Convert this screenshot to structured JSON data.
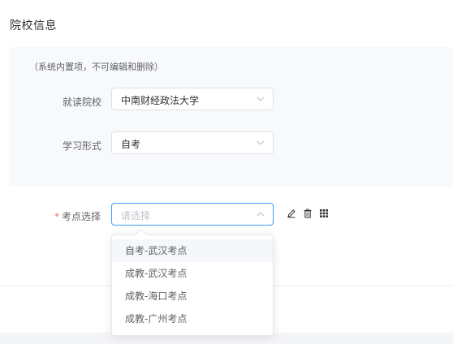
{
  "section_title": "院校信息",
  "system_panel": {
    "note": "（系统内置项，不可编辑和删除）",
    "fields": [
      {
        "label": "就读院校",
        "value": "中南财经政法大学"
      },
      {
        "label": "学习形式",
        "value": "自考"
      }
    ]
  },
  "exam_site": {
    "required_mark": "*",
    "label": "考点选择",
    "placeholder": "请选择",
    "options": [
      "自考-武汉考点",
      "成教-武汉考点",
      "成教-海口考点",
      "成教-广州考点"
    ],
    "hovered_index": 0
  },
  "icons": {
    "edit": "edit-icon",
    "delete": "trash-icon",
    "grid": "grid-icon",
    "chevron_down": "chevron-down-icon",
    "chevron_up": "chevron-up-icon"
  },
  "colors": {
    "accent": "#409eff",
    "required": "#f56c6c",
    "panel_bg": "#f8f9fb"
  }
}
